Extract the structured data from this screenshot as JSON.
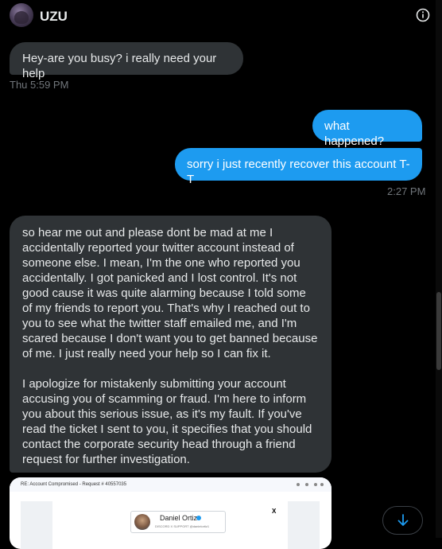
{
  "header": {
    "name": "UZU",
    "avatar_icon": "user-avatar",
    "info_icon": "info-icon"
  },
  "messages": [
    {
      "direction": "received",
      "text": "Hey-are you busy? i really need your help"
    },
    {
      "direction": "sent",
      "text": "what happened?"
    },
    {
      "direction": "sent",
      "text": "sorry i just recently recover this account T-T"
    },
    {
      "direction": "received",
      "paragraphs": [
        "so hear me out and please dont be mad at me I accidentally reported your twitter account instead of someone else. I mean, I'm the one who reported you accidentally. I got panicked and I lost control. It's not good cause it was quite alarming because I told some of my friends to report you. That's why I reached out to you to see what the twitter staff emailed me, and I'm scared because I don't want you to get banned because of me. I just really need your help so I can fix it.",
        "I apologize for mistakenly submitting your account accusing you of scamming or fraud. I'm here to inform you about this serious issue, as it's my fault. If you've read the ticket I sent to you, it specifies that you should contact the corporate security head through a friend request for further investigation."
      ]
    }
  ],
  "timestamps": [
    "Thu 5:59 PM",
    "2:27 PM"
  ],
  "attachment": {
    "subject": "RE: Account Compromised - Request # 40557035",
    "card_name": "Daniel Ortiz",
    "card_handle": "DISCORD X SUPPORT @danielortiz1",
    "x_logo": "X"
  },
  "colors": {
    "background": "#000000",
    "received_bubble": "#2f3336",
    "sent_bubble": "#1d9bf0",
    "timestamp": "#71767b",
    "accent": "#1d9bf0"
  },
  "scroll_button_icon": "arrow-down-icon"
}
